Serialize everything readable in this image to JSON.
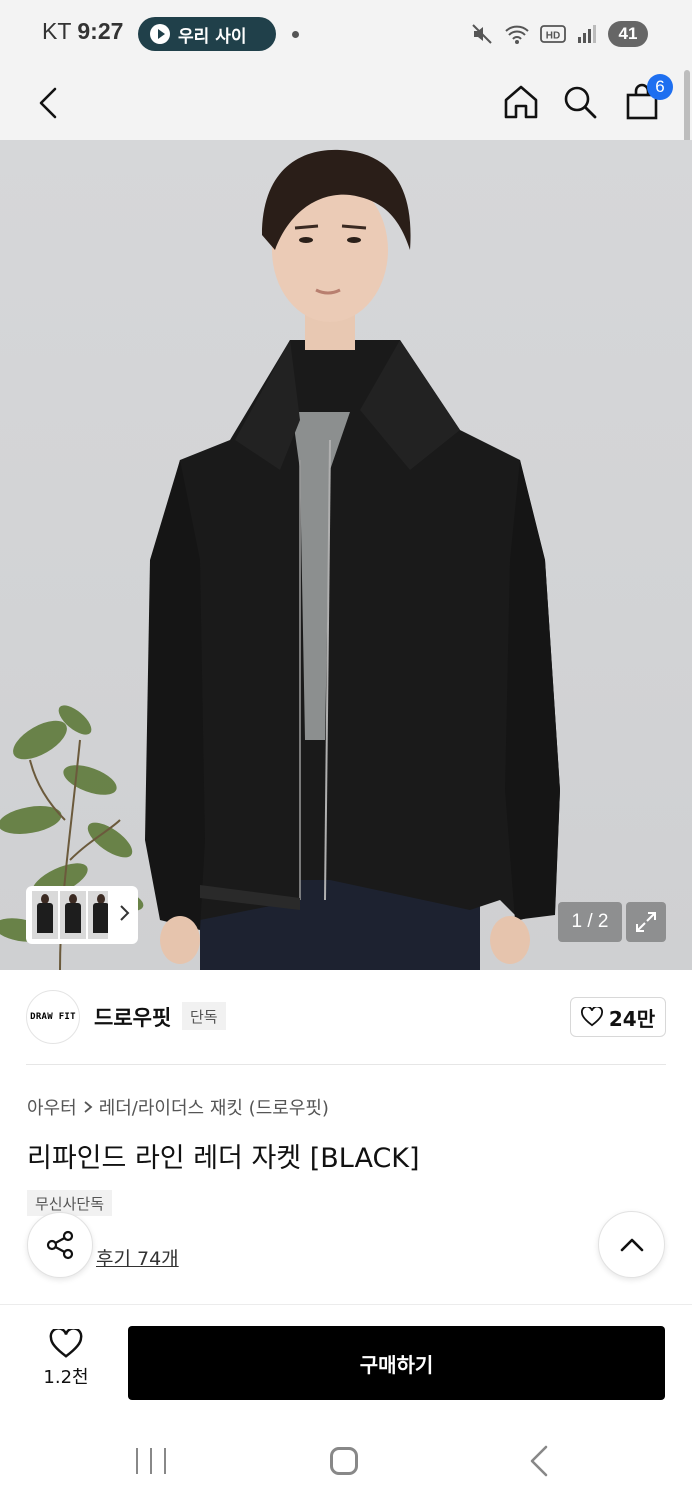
{
  "status_bar": {
    "carrier": "KT",
    "time": "9:27",
    "pill_label": "우리 사이",
    "battery": "41"
  },
  "header": {
    "cart_count": "6"
  },
  "gallery": {
    "page_indicator": "1 / 2"
  },
  "brand": {
    "logo_text": "DRAW FIT",
    "name": "드로우핏",
    "tag": "단독",
    "likes": "24만"
  },
  "product": {
    "breadcrumb": [
      "아우터",
      "레더/라이더스 재킷 (드로우핏)"
    ],
    "title": "리파인드 라인 레더 자켓 [BLACK]",
    "exclusive_tag": "무신사단독",
    "reviews": "후기 74개"
  },
  "bottom_bar": {
    "favorite_count": "1.2천",
    "buy_label": "구매하기"
  },
  "colors": {
    "accent_badge": "#1e6ff0",
    "buy_button": "#000000",
    "pill_bg": "#20404a"
  }
}
